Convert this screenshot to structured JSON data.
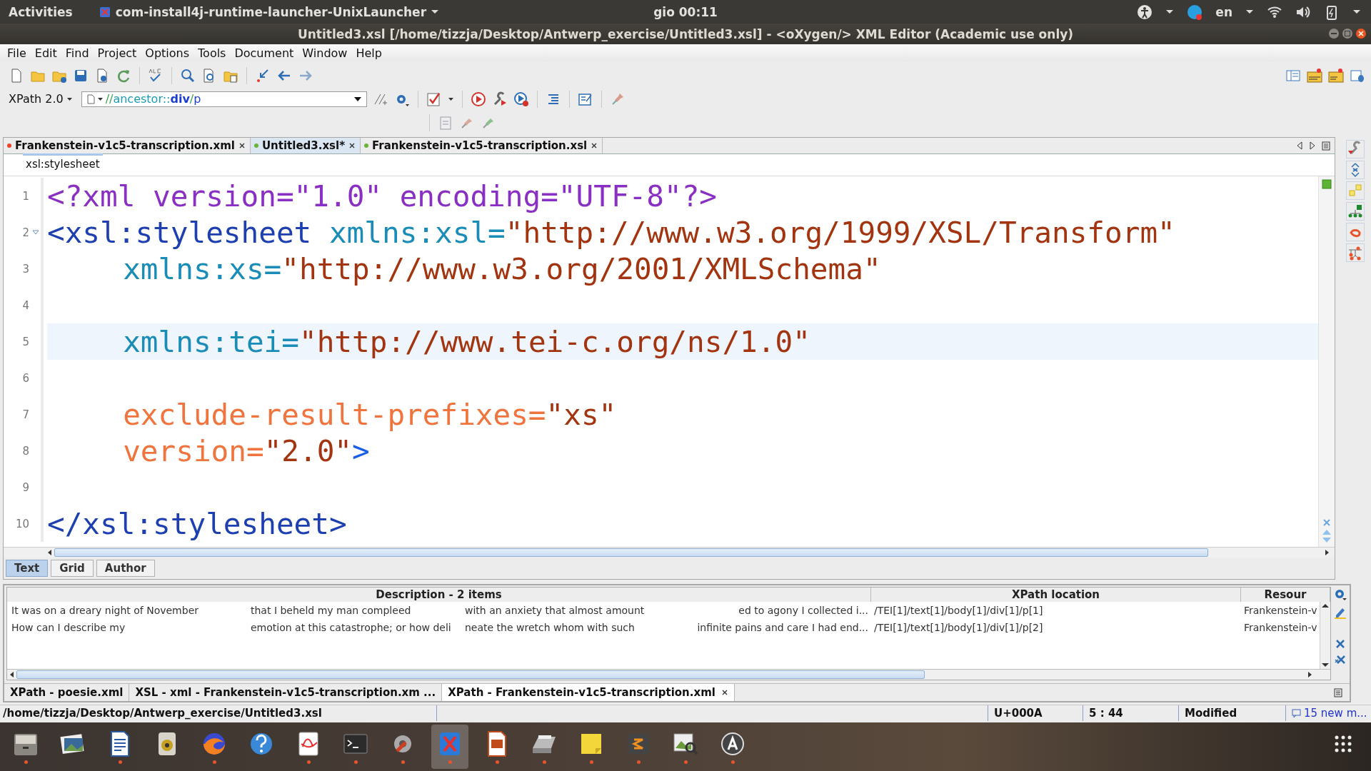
{
  "top_bar": {
    "activities": "Activities",
    "app_name": "com-install4j-runtime-launcher-UnixLauncher",
    "clock": "gio 00:11",
    "language": "en"
  },
  "window": {
    "title": "Untitled3.xsl [/home/tizzja/Desktop/Antwerp_exercise/Untitled3.xsl] - <oXygen/> XML Editor (Academic use only)"
  },
  "menu": [
    "File",
    "Edit",
    "Find",
    "Project",
    "Options",
    "Tools",
    "Document",
    "Window",
    "Help"
  ],
  "xpath": {
    "version": "XPath 2.0",
    "query": [
      {
        "text": "//",
        "kind": "op"
      },
      {
        "text": "ancestor::",
        "kind": "axis"
      },
      {
        "text": "div",
        "kind": "name"
      },
      {
        "text": "/",
        "kind": "op"
      },
      {
        "text": "p",
        "kind": "name"
      }
    ]
  },
  "editor_tabs": [
    {
      "label": "Frankenstein-v1c5-transcription.xml",
      "color": "#e8452c",
      "selected": false
    },
    {
      "label": "Untitled3.xsl*",
      "color": "#6ab43c",
      "selected": true
    },
    {
      "label": "Frankenstein-v1c5-transcription.xsl",
      "color": "#6ab43c",
      "selected": false
    }
  ],
  "breadcrumb": "xsl:stylesheet",
  "code_lines": [
    {
      "number": "1",
      "current": false,
      "foldable": false,
      "indented": false,
      "tokens": [
        {
          "text": "<?xml version=\"1.0\" encoding=\"UTF-8\"?>",
          "kind": "pi"
        }
      ]
    },
    {
      "number": "2",
      "current": false,
      "foldable": true,
      "indented": false,
      "tokens": [
        {
          "text": "<xsl:stylesheet",
          "kind": "tag"
        },
        {
          "text": "xmlns:xsl=",
          "kind": "ns",
          "spaced": true
        },
        {
          "text": "\"http://www.w3.org/1999/XSL/Transform\"",
          "kind": "value"
        }
      ]
    },
    {
      "number": "3",
      "current": false,
      "foldable": false,
      "indented": true,
      "tokens": [
        {
          "text": "xmlns:xs=",
          "kind": "ns"
        },
        {
          "text": "\"http://www.w3.org/2001/XMLSchema\"",
          "kind": "value"
        }
      ]
    },
    {
      "number": "4",
      "current": false,
      "foldable": false
    },
    {
      "number": "5",
      "current": true,
      "foldable": false,
      "indented": true,
      "tokens": [
        {
          "text": "xmlns:tei=",
          "kind": "ns"
        },
        {
          "text": "\"http://www.tei-c.org/ns/1.0\"",
          "kind": "value"
        }
      ]
    },
    {
      "number": "6",
      "current": false,
      "foldable": false
    },
    {
      "number": "7",
      "current": false,
      "foldable": false,
      "indented": true,
      "tokens": [
        {
          "text": "exclude-result-prefixes=",
          "kind": "attr"
        },
        {
          "text": "\"xs\"",
          "kind": "value"
        }
      ]
    },
    {
      "number": "8",
      "current": false,
      "foldable": false,
      "indented": true,
      "tokens": [
        {
          "text": "version=",
          "kind": "attr"
        },
        {
          "text": "\"2.0\"",
          "kind": "value"
        },
        {
          "text": ">",
          "kind": "bracket"
        }
      ]
    },
    {
      "number": "9",
      "current": false,
      "foldable": false
    },
    {
      "number": "10",
      "current": false,
      "foldable": false,
      "indented": false,
      "tokens": [
        {
          "text": "</xsl:stylesheet>",
          "kind": "tag"
        }
      ]
    }
  ],
  "editor_modes": [
    {
      "label": "Text",
      "selected": true
    },
    {
      "label": "Grid",
      "selected": false
    },
    {
      "label": "Author",
      "selected": false
    }
  ],
  "results": {
    "columns": [
      "Description - 2 items",
      "XPath location",
      "Resour"
    ],
    "rows": [
      {
        "description": [
          "It was on a dreary night of November",
          "that I beheld  my man compleed",
          "with an anxiety that almost amount",
          "ed to agony I collected i..."
        ],
        "location": "/TEI[1]/text[1]/body[1]/div[1]/p[1]",
        "resource": "Frankenstein-v"
      },
      {
        "description": [
          "How can I describe my",
          "emotion at this catastrophe; or how deli",
          "neate the wretch whom with such",
          "infinite pains and care I had end..."
        ],
        "location": "/TEI[1]/text[1]/body[1]/div[1]/p[2]",
        "resource": "Frankenstein-v"
      }
    ],
    "tabs": [
      {
        "label": "XPath - poesie.xml",
        "selected": false
      },
      {
        "label": "XSL - xml - Frankenstein-v1c5-transcription.xm ...",
        "selected": false
      },
      {
        "label": "XPath - Frankenstein-v1c5-transcription.xml",
        "selected": true
      }
    ]
  },
  "status_bar": {
    "path": "/home/tizzja/Desktop/Antwerp_exercise/Untitled3.xsl",
    "char": "U+000A",
    "position": "5 : 44",
    "state": "Modified",
    "messages": "15 new m..."
  },
  "dock": [
    {
      "running": true,
      "selected": false
    },
    {
      "running": false,
      "selected": false
    },
    {
      "running": true,
      "selected": false
    },
    {
      "running": false,
      "selected": false
    },
    {
      "running": true,
      "selected": false
    },
    {
      "running": false,
      "selected": false
    },
    {
      "running": true,
      "selected": false
    },
    {
      "running": true,
      "selected": false
    },
    {
      "running": true,
      "selected": false
    },
    {
      "running": true,
      "selected": true
    },
    {
      "running": true,
      "selected": false
    },
    {
      "running": true,
      "selected": false
    },
    {
      "running": true,
      "selected": false
    },
    {
      "running": true,
      "selected": false
    },
    {
      "running": true,
      "selected": false
    },
    {
      "running": true,
      "selected": false
    }
  ]
}
